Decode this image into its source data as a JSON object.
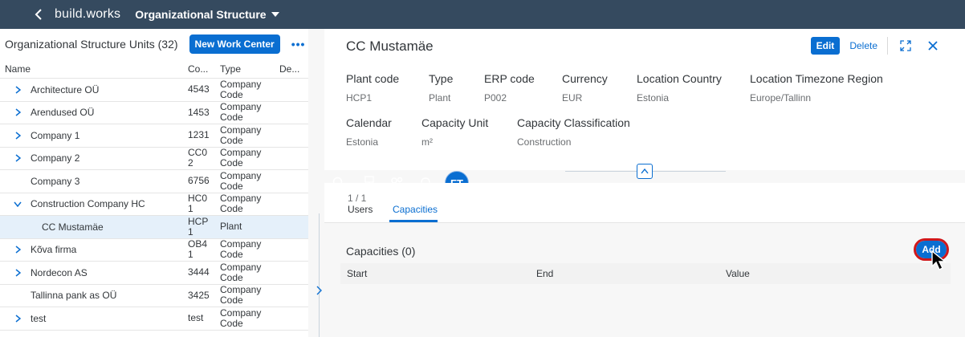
{
  "shell": {
    "brand_part1": "build.",
    "brand_part2": "works",
    "app_title": "Organizational Structure",
    "avatar": "FT",
    "icons": [
      "search-icon",
      "org-chart-icon",
      "people-icon",
      "bell-icon"
    ]
  },
  "left": {
    "title": "Organizational Structure Units (32)",
    "new_button": "New Work Center",
    "more": "•••",
    "columns": {
      "name": "Name",
      "code": "Co...",
      "type": "Type",
      "desc": "De..."
    },
    "rows": [
      {
        "name": "Architecture OÜ",
        "code": "4543",
        "type1": "Company",
        "type2": "Code"
      },
      {
        "name": "Arendused OÜ",
        "code": "1453",
        "type1": "Company",
        "type2": "Code"
      },
      {
        "name": "Company 1",
        "code": "1231",
        "type1": "Company",
        "type2": "Code"
      },
      {
        "name": "Company 2",
        "code1": "CC0",
        "code2": "2",
        "type1": "Company",
        "type2": "Code"
      },
      {
        "name": "Company 3",
        "code": "6756",
        "type1": "Company",
        "type2": "Code"
      },
      {
        "name": "Construction Company HC",
        "code1": "HC0",
        "code2": "1",
        "type1": "Company",
        "type2": "Code"
      },
      {
        "name": "CC Mustamäe",
        "code1": "HCP",
        "code2": "1",
        "type": "Plant"
      },
      {
        "name": "Kõva firma",
        "code1": "OB4",
        "code2": "1",
        "type1": "Company",
        "type2": "Code"
      },
      {
        "name": "Nordecon AS",
        "code": "3444",
        "type1": "Company",
        "type2": "Code"
      },
      {
        "name": "Tallinna pank as OÜ",
        "code": "3425",
        "type1": "Company",
        "type2": "Code"
      },
      {
        "name": "test",
        "code": "test",
        "type1": "Company",
        "type2": "Code"
      }
    ]
  },
  "detail": {
    "title": "CC Mustamäe",
    "edit": "Edit",
    "delete": "Delete",
    "attrs": [
      {
        "label": "Plant code",
        "value": "HCP1"
      },
      {
        "label": "Type",
        "value": "Plant"
      },
      {
        "label": "ERP code",
        "value": "P002"
      },
      {
        "label": "Currency",
        "value": "EUR"
      },
      {
        "label": "Location Country",
        "value": "Estonia"
      },
      {
        "label": "Location Timezone Region",
        "value": "Europe/Tallinn"
      },
      {
        "label": "Calendar",
        "value": "Estonia"
      },
      {
        "label": "Capacity Unit",
        "value": "m²"
      },
      {
        "label": "Capacity Classification",
        "value": "Construction"
      }
    ],
    "tabs": [
      {
        "count": "1 / 1",
        "label": "Users"
      },
      {
        "count": "",
        "label": "Capacities"
      }
    ],
    "capacities": {
      "title": "Capacities (0)",
      "add": "Add",
      "columns": [
        "Start",
        "End",
        "Value"
      ]
    }
  },
  "colors": {
    "shell": "#354a5f",
    "accent": "#0a6ed1",
    "highlight": "#d0181b",
    "selected_row": "#e5f0fa"
  }
}
